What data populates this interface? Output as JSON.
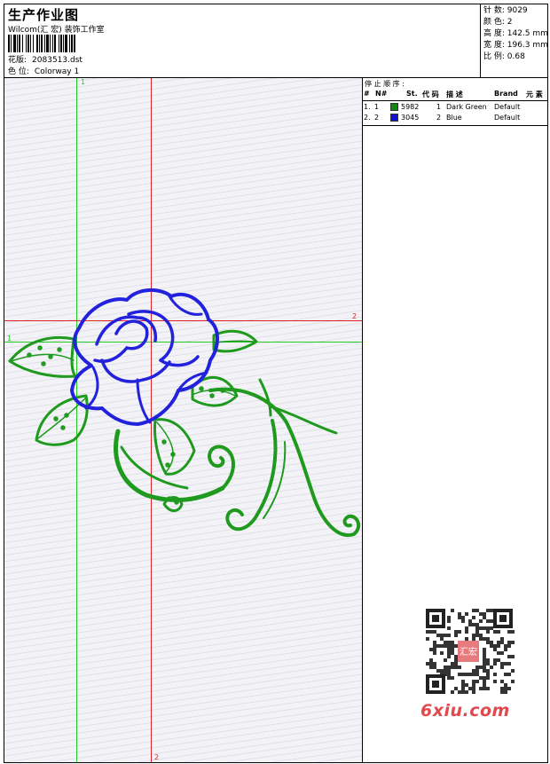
{
  "header": {
    "title": "生产作业图",
    "studio": "Wilcom(汇 宏) 装饰工作室",
    "design_label": "花版:",
    "design_value": "2083513.dst",
    "colorway_label": "色 位:",
    "colorway_value": "Colorway 1"
  },
  "stats": {
    "stitches": "针 数:  9029",
    "colors": "颜 色:  2",
    "height": "高 度:  142.5 mm",
    "width": "宽 度:  196.3 mm",
    "ratio": "比 例:  0.68"
  },
  "guides": {
    "green_v_label": "1",
    "green_h_label": "1",
    "red_h_label": "2",
    "red_v_label": "2",
    "green_color": "#22cc22",
    "red_color": "#dd2222"
  },
  "stop_sequence": {
    "title": "停 止 顺 序 :",
    "columns": [
      "#",
      "N#",
      "St.",
      "代 码",
      "描 述",
      "Brand",
      "元 素"
    ],
    "rows": [
      {
        "idx": "1.",
        "num": "1",
        "color": "#0a8a0a",
        "stitches": "5982",
        "code": "1",
        "description": "Dark Green",
        "brand": "Default"
      },
      {
        "idx": "2.",
        "num": "2",
        "color": "#1010d8",
        "stitches": "3045",
        "code": "2",
        "description": "Blue",
        "brand": "Default"
      }
    ]
  },
  "embroidery": {
    "green": "#1f9a1f",
    "blue": "#2222dd"
  },
  "watermark": {
    "text": "6xiu.com",
    "stamp_text": "汇宏",
    "color": "#e0494d"
  }
}
